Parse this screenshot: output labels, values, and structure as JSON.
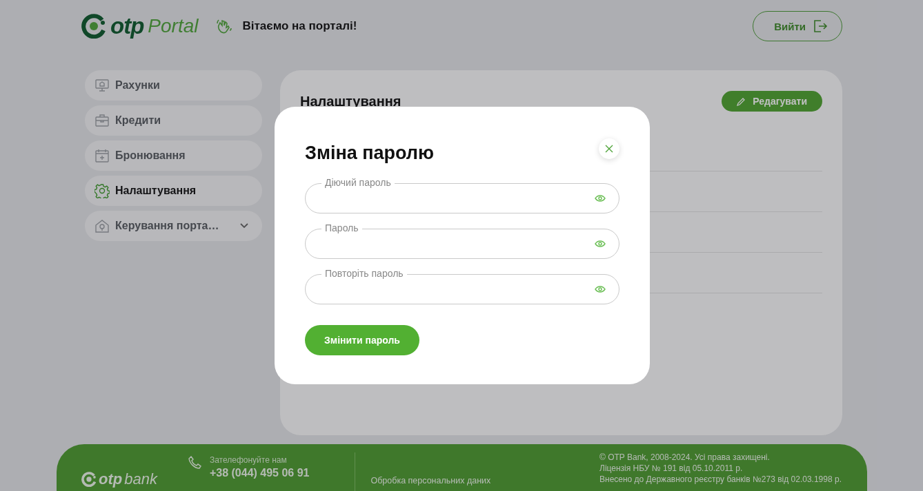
{
  "header": {
    "logo": {
      "brand": "otp",
      "product": "Portal"
    },
    "greeting": "Вітаємо на порталі!",
    "logout_button": "Вийти"
  },
  "sidebar": {
    "items": [
      {
        "label": "Рахунки",
        "kind": "link",
        "selected": false
      },
      {
        "label": "Кредити",
        "kind": "link",
        "selected": false
      },
      {
        "label": "Бронювання",
        "kind": "link",
        "selected": false
      },
      {
        "label": "Налаштування",
        "kind": "link",
        "selected": true
      },
      {
        "label": "Керування порта…",
        "kind": "group",
        "selected": false
      }
    ]
  },
  "settings_panel": {
    "title": "Налаштування",
    "edit_button": "Редагувати"
  },
  "modal": {
    "title": "Зміна паролю",
    "fields": [
      {
        "label": "Діючий пароль"
      },
      {
        "label": "Пароль"
      },
      {
        "label": "Повторіть пароль"
      }
    ],
    "submit_button": "Змінити пароль"
  },
  "footer": {
    "logo": {
      "brand": "otp",
      "product": "bank"
    },
    "call_label": "Зателефонуйте нам",
    "phone": "+38 (044) 495 06 91",
    "privacy_link": "Обробка персональних даних",
    "legal": [
      "© OTP Bank, 2008-2024. Усі права захищені.",
      "Ліцензія НБУ № 191 від 05.10.2011 р.",
      "Внесено до Державного реєстру банків №273 від 02.03.1998 р."
    ]
  }
}
